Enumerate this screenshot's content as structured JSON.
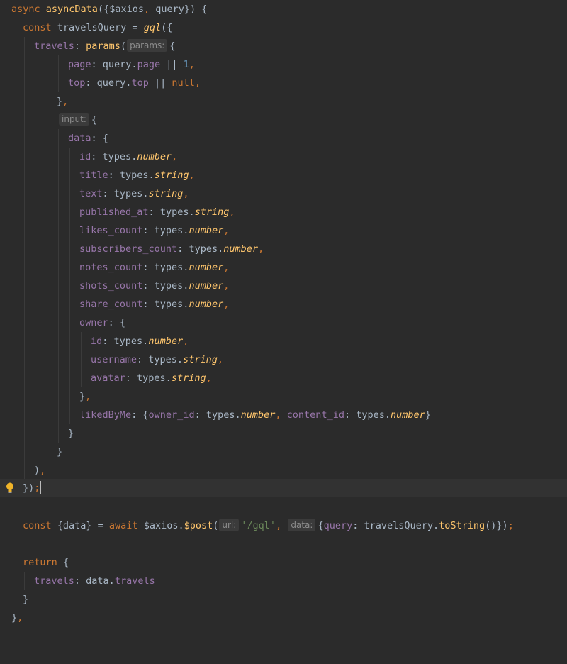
{
  "editor": {
    "hints": {
      "params": "params:",
      "input": "input:",
      "url": "url:",
      "data": "data:"
    },
    "colors": {
      "background": "#2b2b2b",
      "current_line": "#323232",
      "keyword": "#cc7832",
      "function": "#ffc66d",
      "property": "#9876aa",
      "number": "#6897bb",
      "string": "#6a8759",
      "text": "#a9b7c6"
    },
    "icons": [
      "lightbulb-icon"
    ]
  },
  "code": {
    "l1": {
      "async": "async",
      "name": "asyncData",
      "open": "({",
      "axios": "$axios",
      "comma": ",",
      "query": " query",
      "close": "}) {"
    },
    "l2": {
      "const": "const",
      "name": " travelsQuery = ",
      "gql": "gql",
      "open": "({"
    },
    "l3": {
      "prop": "travels",
      "colon": ": ",
      "fn": "params",
      "paren": "(",
      "brace": "{"
    },
    "l4": {
      "prop": "page",
      "colon": ": ",
      "obj": "query.",
      "member": "page",
      "op": " || ",
      "num": "1",
      "comma": ","
    },
    "l5": {
      "prop": "top",
      "colon": ": ",
      "obj": "query.",
      "member": "top",
      "op": " || ",
      "null": "null",
      "comma": ","
    },
    "l6": {
      "brace": "}",
      "comma": ","
    },
    "l7": {
      "brace": "{"
    },
    "l8": {
      "prop": "data",
      "colon": ": {"
    },
    "l9": {
      "prop": "id",
      "colon": ": ",
      "types": "types.",
      "type": "number",
      "comma": ","
    },
    "l10": {
      "prop": "title",
      "colon": ": ",
      "types": "types.",
      "type": "string",
      "comma": ","
    },
    "l11": {
      "prop": "text",
      "colon": ": ",
      "types": "types.",
      "type": "string",
      "comma": ","
    },
    "l12": {
      "prop": "published_at",
      "colon": ": ",
      "types": "types.",
      "type": "string",
      "comma": ","
    },
    "l13": {
      "prop": "likes_count",
      "colon": ": ",
      "types": "types.",
      "type": "number",
      "comma": ","
    },
    "l14": {
      "prop": "subscribers_count",
      "colon": ": ",
      "types": "types.",
      "type": "number",
      "comma": ","
    },
    "l15": {
      "prop": "notes_count",
      "colon": ": ",
      "types": "types.",
      "type": "number",
      "comma": ","
    },
    "l16": {
      "prop": "shots_count",
      "colon": ": ",
      "types": "types.",
      "type": "number",
      "comma": ","
    },
    "l17": {
      "prop": "share_count",
      "colon": ": ",
      "types": "types.",
      "type": "number",
      "comma": ","
    },
    "l18": {
      "prop": "owner",
      "colon": ": {"
    },
    "l19": {
      "prop": "id",
      "colon": ": ",
      "types": "types.",
      "type": "number",
      "comma": ","
    },
    "l20": {
      "prop": "username",
      "colon": ": ",
      "types": "types.",
      "type": "string",
      "comma": ","
    },
    "l21": {
      "prop": "avatar",
      "colon": ": ",
      "types": "types.",
      "type": "string",
      "comma": ","
    },
    "l22": {
      "brace": "}",
      "comma": ","
    },
    "l23": {
      "prop": "likedByMe",
      "colon": ": {",
      "p1": "owner_id",
      "c1": ": ",
      "types1": "types.",
      "type1": "number",
      "comma": ", ",
      "p2": "content_id",
      "c2": ": ",
      "types2": "types.",
      "type2": "number",
      "close": "}"
    },
    "l24": {
      "brace": "}"
    },
    "l25": {
      "brace": "}"
    },
    "l26": {
      "paren": ")",
      "comma": ","
    },
    "l27": {
      "close": "})",
      "semi": ";"
    },
    "l29": {
      "const": "const",
      "destructure": " {data} = ",
      "await": "await",
      "obj": " $axios.",
      "fn": "$post",
      "paren": "(",
      "url": "'/gql'",
      "comma": ",",
      "open": "{",
      "prop": "query",
      "colon": ": travelsQuery.",
      "method": "toString",
      "close": "()})",
      "semi": ";"
    },
    "l31": {
      "ret": "return",
      "brace": " {"
    },
    "l32": {
      "prop": "travels",
      "colon": ": data.",
      "member": "travels"
    },
    "l33": {
      "brace": "}"
    },
    "l34": {
      "brace": "}",
      "comma": ","
    }
  }
}
